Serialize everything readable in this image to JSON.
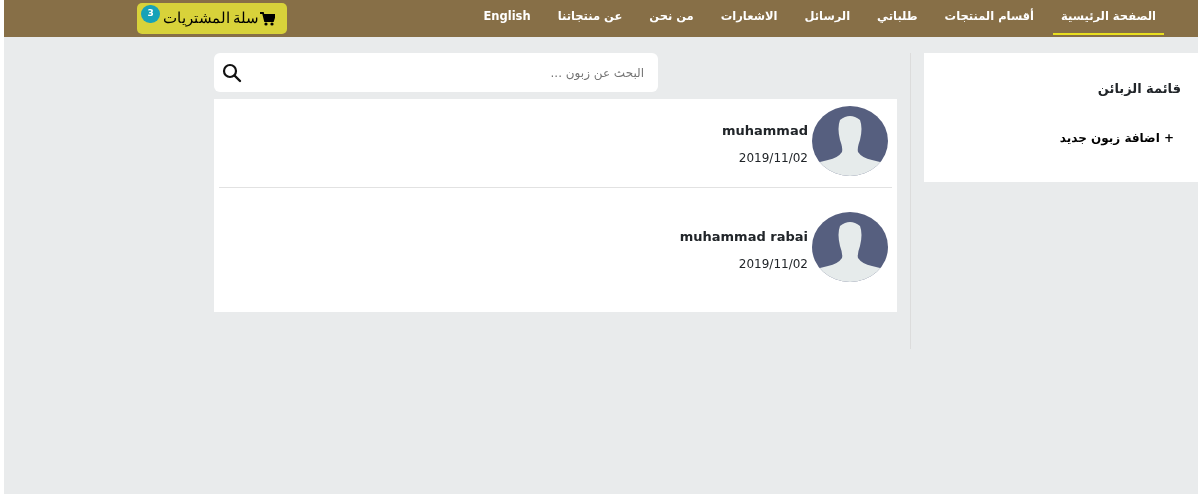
{
  "nav": {
    "items": [
      {
        "label": "الصفحة الرئيسية",
        "selected": true
      },
      {
        "label": "أقسام المنتجات",
        "selected": false
      },
      {
        "label": "طلباتي",
        "selected": false
      },
      {
        "label": "الرسائل",
        "selected": false
      },
      {
        "label": "الاشعارات",
        "selected": false
      },
      {
        "label": "من نحن",
        "selected": false
      },
      {
        "label": "عن منتجاتنا",
        "selected": false
      },
      {
        "label": "English",
        "selected": false
      }
    ],
    "cart": {
      "label": "سلة المشتريات",
      "count": "3"
    }
  },
  "sidebar": {
    "title": "قائمة الزبائن",
    "items": [
      {
        "label": "+ اضافة زبون جديد"
      }
    ]
  },
  "search": {
    "placeholder": "البحث عن زبون ..."
  },
  "customers": [
    {
      "name": "muhammad",
      "date": "2019/11/02"
    },
    {
      "name": "muhammad rabai",
      "date": "2019/11/02"
    }
  ]
}
